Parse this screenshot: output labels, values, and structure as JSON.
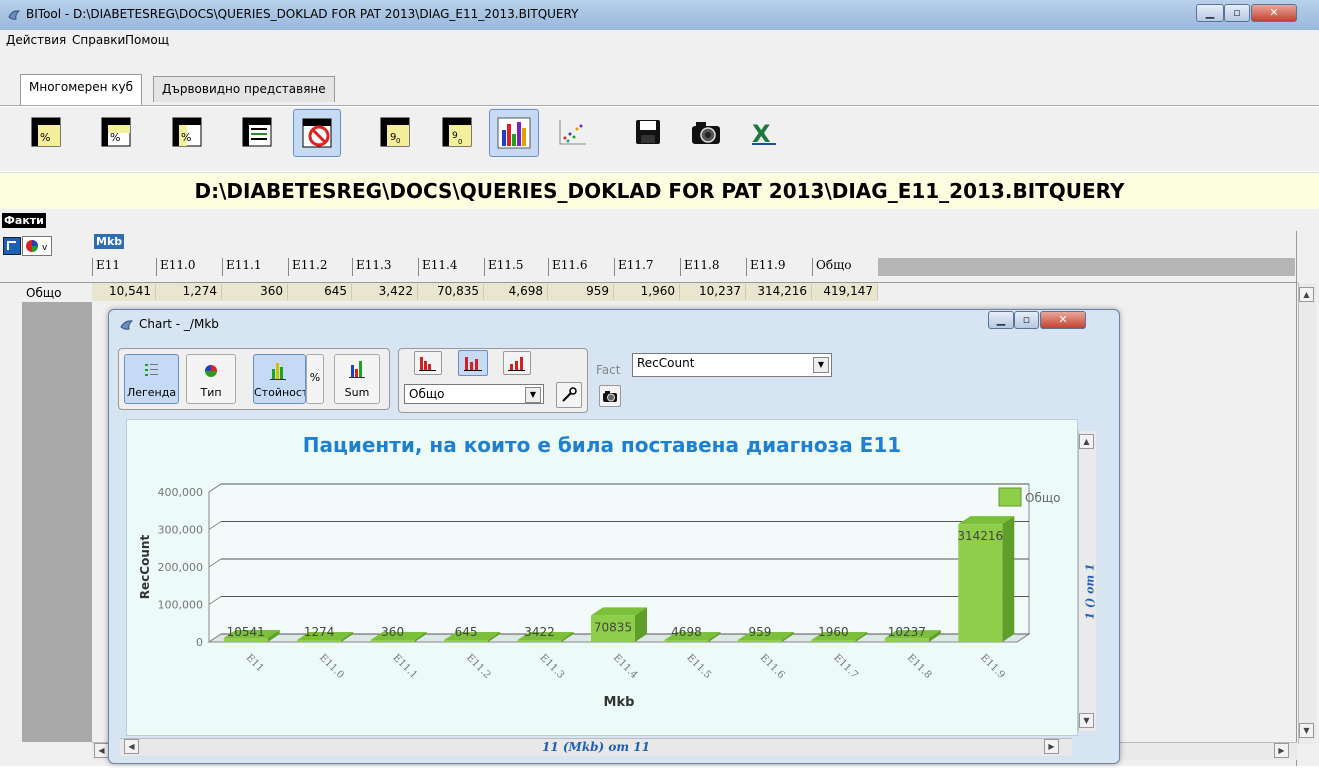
{
  "window": {
    "title": "BITool - D:\\DIABETESREG\\DOCS\\QUERIES_DOKLAD FOR PAT 2013\\DIAG_E11_2013.BITQUERY"
  },
  "menu": [
    "Действия",
    "Справки",
    "Помощ"
  ],
  "tabs": [
    "Многомерен куб",
    "Дървовидно представяне"
  ],
  "path_banner": "D:\\DIABETESREG\\DOCS\\QUERIES_DOKLAD FOR PAT 2013\\DIAG_E11_2013.BITQUERY",
  "facts_label": "Факти",
  "dimension_label": "Mkb",
  "grid": {
    "columns": [
      "E11",
      "E11.0",
      "E11.1",
      "E11.2",
      "E11.3",
      "E11.4",
      "E11.5",
      "E11.6",
      "E11.7",
      "E11.8",
      "E11.9",
      "Общо"
    ],
    "row_label": "Общо",
    "values": [
      "10,541",
      "1,274",
      "360",
      "645",
      "3,422",
      "70,835",
      "4,698",
      "959",
      "1,960",
      "10,237",
      "314,216",
      "419,147"
    ]
  },
  "chart_window": {
    "title": "Chart - _/Mkb",
    "buttons": {
      "legend": "Легенда",
      "type": "Тип",
      "values": "Стойности",
      "percent": "%",
      "sum": "Sum"
    },
    "series_select": "Общо",
    "fact_label": "Fact",
    "fact_select": "RecCount",
    "side_pager": "1 () от 1",
    "bottom_pager": "11 (Mkb) от 11"
  },
  "chart_data": {
    "type": "bar",
    "title": "Пациенти, на които е била поставена диагноза Е11",
    "xlabel": "Mkb",
    "ylabel": "RecCount",
    "categories": [
      "E11",
      "E11.0",
      "E11.1",
      "E11.2",
      "E11.3",
      "E11.4",
      "E11.5",
      "E11.6",
      "E11.7",
      "E11.8",
      "E11.9"
    ],
    "series": [
      {
        "name": "Общо",
        "values": [
          10541,
          1274,
          360,
          645,
          3422,
          70835,
          4698,
          959,
          1960,
          10237,
          314216
        ]
      }
    ],
    "ylim": [
      0,
      400000
    ],
    "yticks": [
      "0",
      "100,000",
      "200,000",
      "300,000",
      "400,000"
    ],
    "legend": "right",
    "grid": true,
    "colors": {
      "bar": "#8fce4a",
      "bar_dark": "#5e9e2a",
      "title": "#1f7fd0"
    }
  }
}
